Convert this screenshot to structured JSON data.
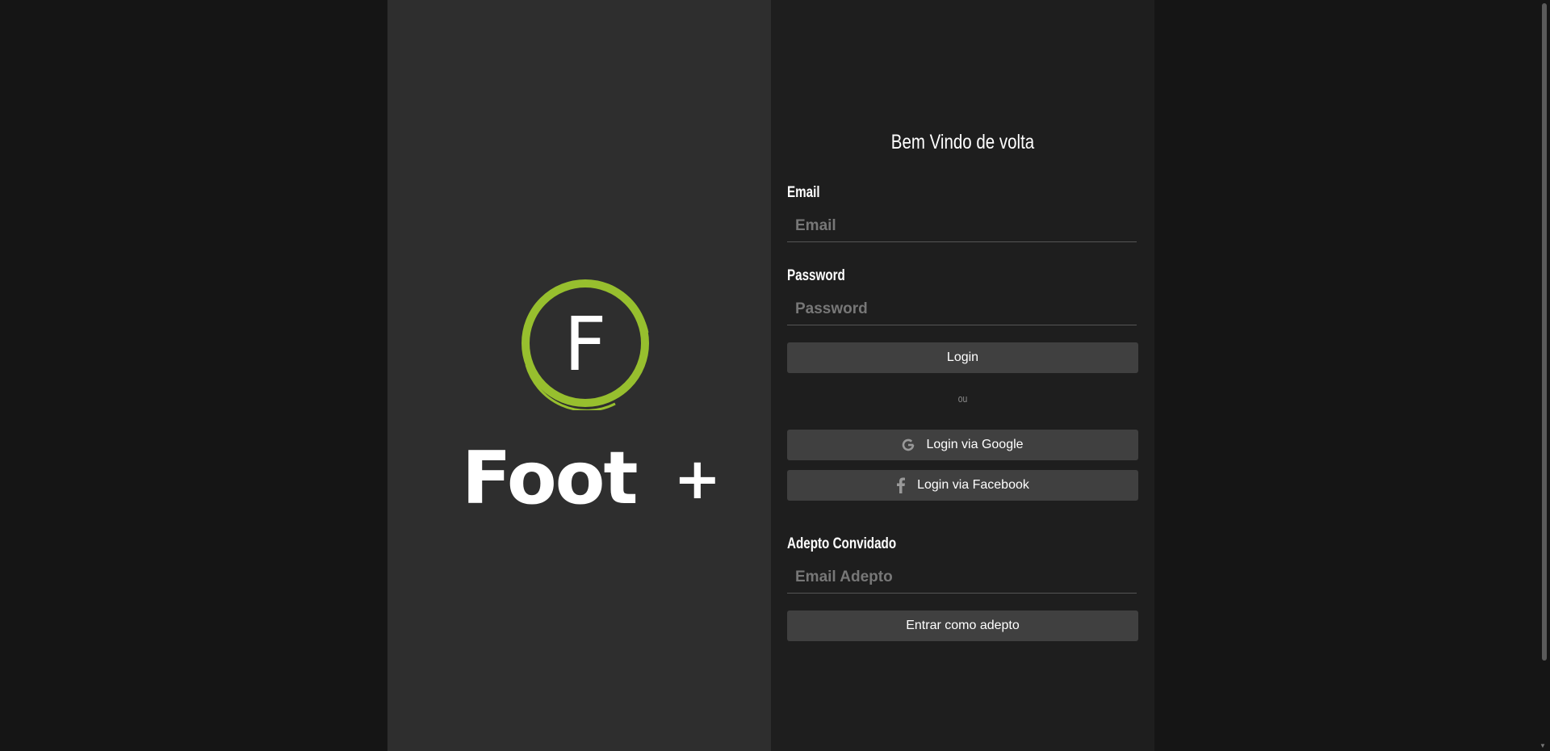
{
  "brand": {
    "logo_letter": "F",
    "wordmark": "Foot",
    "wordmark_plus": "+",
    "accent_color": "#97bf2e"
  },
  "login": {
    "title": "Bem Vindo de volta",
    "email_label": "Email",
    "email_placeholder": "Email",
    "password_label": "Password",
    "password_placeholder": "Password",
    "login_button": "Login",
    "or_text": "ou",
    "google_button": "Login via Google",
    "google_icon": "google-icon",
    "facebook_button": "Login via Facebook",
    "facebook_icon": "facebook-icon"
  },
  "guest": {
    "label": "Adepto Convidado",
    "email_placeholder": "Email Adepto",
    "enter_button": "Entrar como adepto"
  }
}
